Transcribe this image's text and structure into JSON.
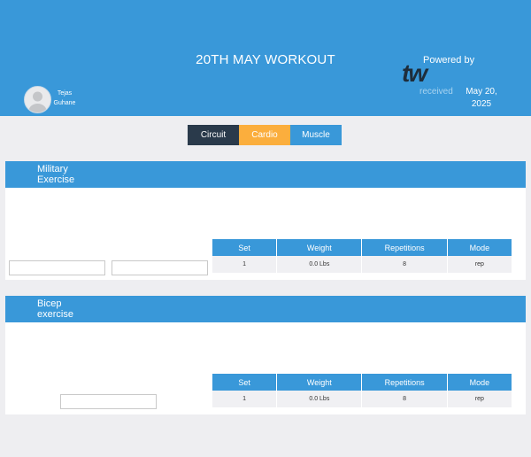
{
  "header": {
    "title": "20TH MAY WORKOUT",
    "user": {
      "first_name": "Tejas",
      "last_name": "Guhane"
    },
    "powered_by": "Powered by",
    "logo_text": "tw",
    "received_label": "received",
    "date_line1": "May 20,",
    "date_line2": "2025"
  },
  "tabs": [
    {
      "label": "Circuit",
      "color": "#2a3a4b"
    },
    {
      "label": "Cardio",
      "color": "#fbae3d"
    },
    {
      "label": "Muscle",
      "color": "#3998d9"
    }
  ],
  "table_headers": [
    "Set",
    "Weight",
    "Repetitions",
    "Mode"
  ],
  "exercises": [
    {
      "title_line1": "Military",
      "title_line2": "Exercise",
      "rows": [
        {
          "set": "1",
          "weight": "0.0 Lbs",
          "reps": "8",
          "mode": "rep"
        }
      ]
    },
    {
      "title_line1": "Bicep",
      "title_line2": "exercise",
      "rows": [
        {
          "set": "1",
          "weight": "0.0 Lbs",
          "reps": "8",
          "mode": "rep"
        }
      ]
    }
  ],
  "colors": {
    "primary": "#3998d9",
    "dark": "#2a3a4b",
    "accent": "#fbae3d",
    "background": "#eeeef1"
  }
}
